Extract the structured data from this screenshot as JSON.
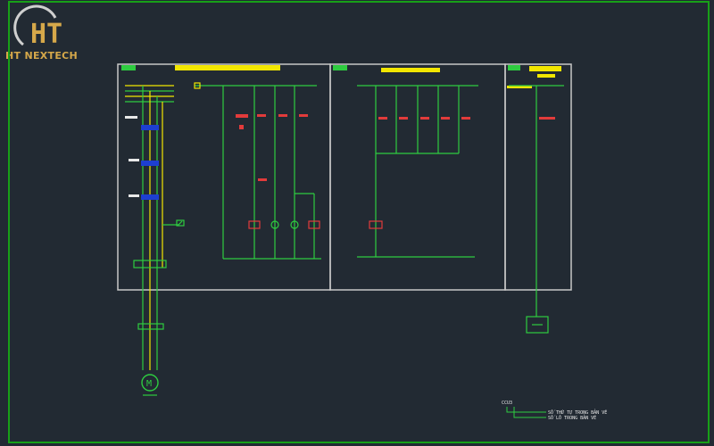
{
  "brand": {
    "logo_letters": "HT",
    "name": "HT NEXTECH"
  },
  "drawing": {
    "motor_symbol": "M",
    "legend": {
      "tag": "CCU3",
      "line1": "SỐ THỨ TỰ TRONG BẢN VẼ",
      "line2": "SỐ LÔ TRONG BẢN VẼ"
    }
  },
  "colors": {
    "background": "#222a33",
    "frame": "#18a018",
    "panel_border": "#c8c8c8",
    "wire": "#2ecc40",
    "title_bar": "#f2e600",
    "terminal": "#1d3fd1",
    "contact": "#e23b3b",
    "brand": "#d6a84a"
  }
}
